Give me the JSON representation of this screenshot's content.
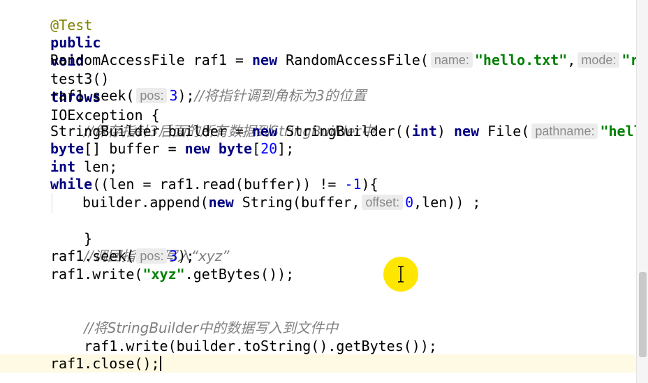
{
  "editor": {
    "line1": {
      "annotation": "@Test"
    },
    "line2": {
      "kw_public": "public",
      "kw_void": "void",
      "method": "test3()",
      "kw_throws": "throws",
      "exception": "IOException {"
    },
    "line3": {
      "decl": "RandomAccessFile raf1 = ",
      "kw_new": "new",
      "ctor": "RandomAccessFile(",
      "hint_name": "name:",
      "str_file": "\"hello.txt\"",
      "comma": ",",
      "hint_mode": "mode:",
      "str_mode": "\"rw"
    },
    "line4": {
      "call": "raf1.seek(",
      "hint_pos": "pos:",
      "num": "3",
      "close": ");",
      "comment": "//将指针调到角标为3的位置"
    },
    "line5": {
      "comment": "//保存指针3后面的所有数据到StringBuilder中"
    },
    "line6": {
      "decl": "StringBuilder builder = ",
      "kw_new": "new",
      "ctor": "StringBuilder((",
      "kw_int": "int",
      "cast_close": ") ",
      "kw_new2": "new",
      "file_ctor": "File(",
      "hint_pathname": "pathname:",
      "str_hello": "\"hello"
    },
    "line7": {
      "kw_byte": "byte",
      "decl": "[] buffer = ",
      "kw_new": "new",
      "kw_byte2": "byte",
      "open": "[",
      "num": "20",
      "close": "];"
    },
    "line8": {
      "kw_int": "int",
      "rest": "len;"
    },
    "line9": {
      "kw_while": "while",
      "cond": "((len = raf1.read(buffer)) != ",
      "num": "-1",
      "close": "){"
    },
    "line10": {
      "call": "builder.append(",
      "kw_new": "new",
      "ctor": "String(buffer,",
      "hint_offset": "offset:",
      "num": "0",
      "rest": ",len)) ;"
    },
    "line11": {
      "brace": "}"
    },
    "line12": {
      "comment": "//调回指针，写入“xyz”"
    },
    "line13": {
      "call": "raf1.seek(",
      "hint_pos": "pos:",
      "num": "3",
      "close": ");"
    },
    "line14": {
      "call": "raf1.write(",
      "str": "\"xyz\"",
      "rest": ".getBytes());"
    },
    "line15": {
      "comment": "//将StringBuilder中的数据写入到文件中"
    },
    "line16": {
      "code": "raf1.write(builder.toString().getBytes());"
    },
    "line17": {
      "code": "raf1.close();"
    }
  },
  "colors": {
    "keyword": "#000080",
    "number": "#0000ff",
    "string": "#008000",
    "annotation": "#808000",
    "comment": "#808080",
    "current_line": "#fffae3",
    "cursor_highlight": "#ffe600"
  },
  "icons": {
    "mouse_pointer": "i-beam-cursor-icon"
  }
}
